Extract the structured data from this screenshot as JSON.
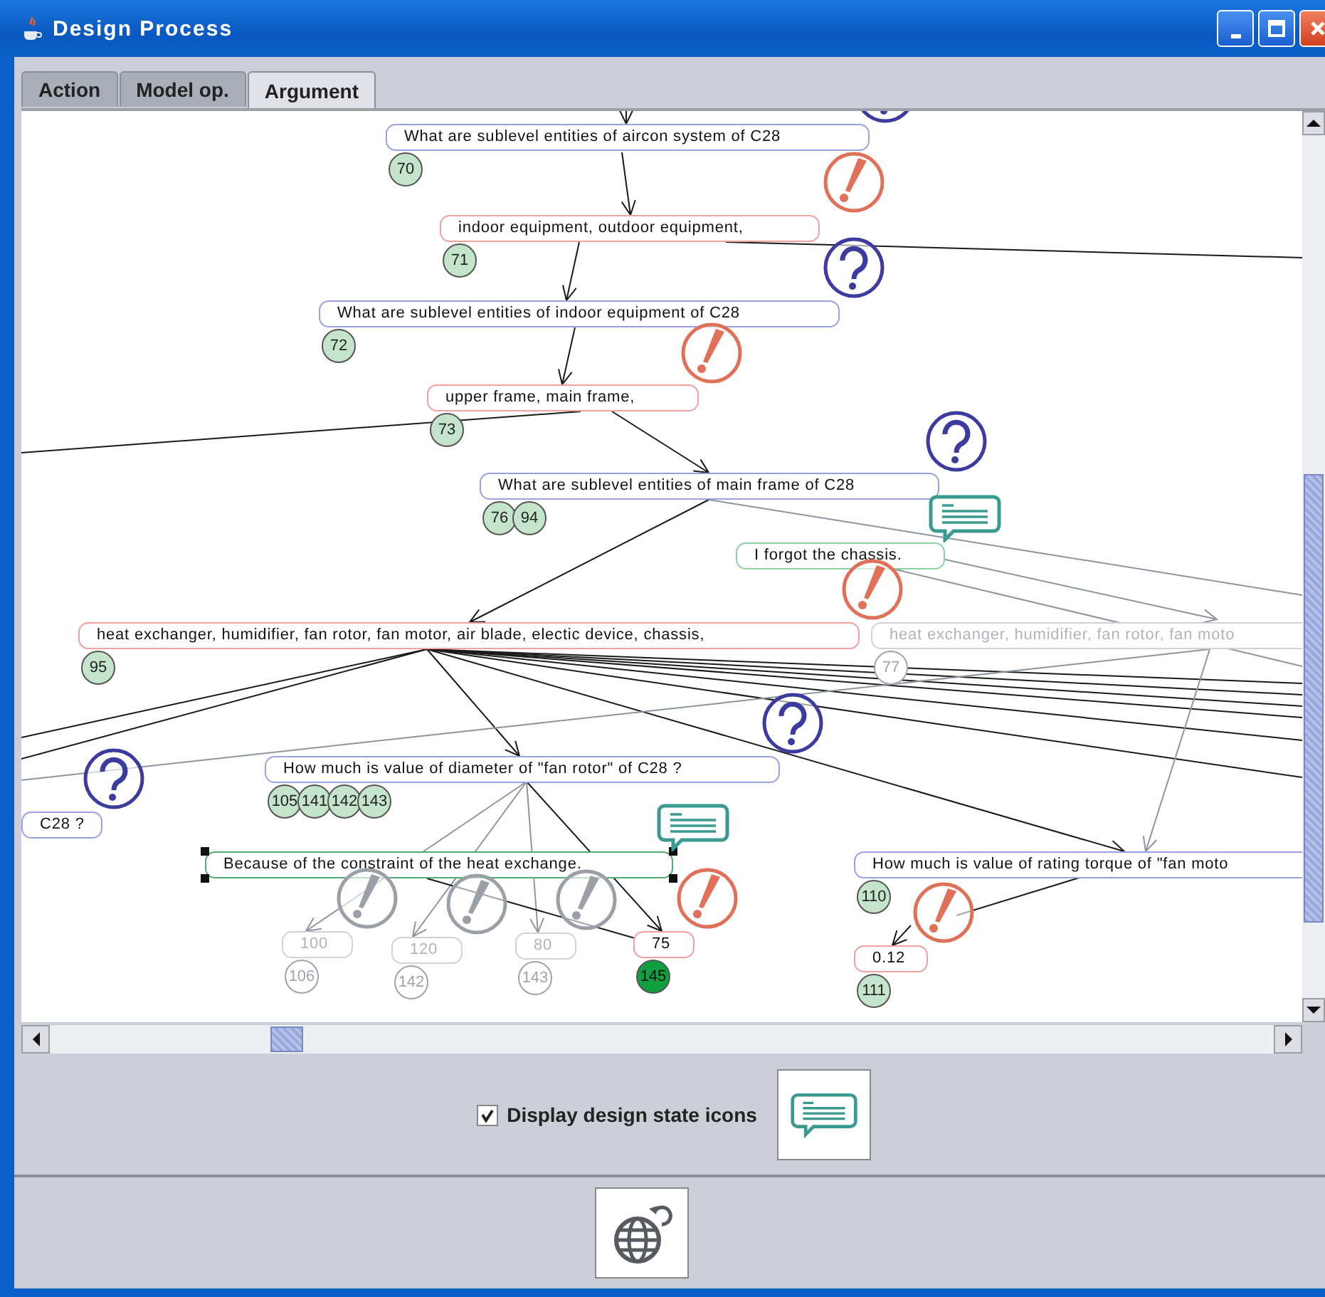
{
  "window": {
    "title": "Design Process"
  },
  "tabs": [
    {
      "label": "Action",
      "selected": false
    },
    {
      "label": "Model op.",
      "selected": false
    },
    {
      "label": "Argument",
      "selected": true
    }
  ],
  "nodes": [
    {
      "kind": "question",
      "text": "What are sublevel entities of aircon system of C28",
      "active": true,
      "selected": false,
      "badges": [
        {
          "label": "70",
          "highlighted": false
        }
      ]
    },
    {
      "kind": "answer",
      "text": "indoor equipment, outdoor equipment,",
      "active": true,
      "selected": false,
      "badges": [
        {
          "label": "71",
          "highlighted": false
        }
      ]
    },
    {
      "kind": "question",
      "text": "What are sublevel entities of indoor equipment of C28",
      "active": true,
      "selected": false,
      "badges": [
        {
          "label": "72",
          "highlighted": false
        }
      ]
    },
    {
      "kind": "answer",
      "text": "upper frame, main frame,",
      "active": true,
      "selected": false,
      "badges": [
        {
          "label": "73",
          "highlighted": false
        }
      ]
    },
    {
      "kind": "question",
      "text": "What are sublevel entities of main frame of C28",
      "active": true,
      "selected": false,
      "badges": [
        {
          "label": "76",
          "highlighted": false
        },
        {
          "label": "94",
          "highlighted": false
        }
      ]
    },
    {
      "kind": "comment",
      "text": "I forgot the chassis.",
      "active": true,
      "selected": false
    },
    {
      "kind": "answer",
      "text": "heat exchanger, humidifier, fan rotor, fan motor, air blade, electic device, chassis,",
      "active": true,
      "selected": false,
      "badges": [
        {
          "label": "95",
          "highlighted": false
        }
      ]
    },
    {
      "kind": "answer",
      "text": "heat exchanger, humidifier, fan rotor, fan moto",
      "active": false,
      "selected": false,
      "badges": [
        {
          "label": "77",
          "highlighted": false
        }
      ]
    },
    {
      "kind": "question",
      "text": "How much is value of diameter of \"fan rotor\" of C28 ?",
      "active": true,
      "selected": false,
      "badges": [
        {
          "label": "105",
          "highlighted": false
        },
        {
          "label": "141",
          "highlighted": false
        },
        {
          "label": "142",
          "highlighted": false
        },
        {
          "label": "143",
          "highlighted": false
        }
      ]
    },
    {
      "kind": "question",
      "text": "C28 ?",
      "active": true,
      "selected": false
    },
    {
      "kind": "comment",
      "text": "Because of the constraint of the heat exchange.",
      "active": true,
      "selected": true
    },
    {
      "kind": "answer",
      "text": "100",
      "active": false,
      "selected": false,
      "badges": [
        {
          "label": "106",
          "highlighted": false
        }
      ]
    },
    {
      "kind": "answer",
      "text": "120",
      "active": false,
      "selected": false,
      "badges": [
        {
          "label": "142",
          "highlighted": false
        }
      ]
    },
    {
      "kind": "answer",
      "text": "80",
      "active": false,
      "selected": false,
      "badges": [
        {
          "label": "143",
          "highlighted": false
        }
      ]
    },
    {
      "kind": "answer",
      "text": "75",
      "active": true,
      "selected": false,
      "badges": [
        {
          "label": "145",
          "highlighted": true
        }
      ]
    },
    {
      "kind": "question",
      "text": "How much is value of rating torque of \"fan moto",
      "active": true,
      "selected": false,
      "badges": [
        {
          "label": "110",
          "highlighted": false
        }
      ]
    },
    {
      "kind": "answer",
      "text": "0.12",
      "active": true,
      "selected": false,
      "badges": [
        {
          "label": "111",
          "highlighted": false
        }
      ]
    }
  ],
  "display_icons": {
    "label": "Display design state icons",
    "checked": true
  }
}
